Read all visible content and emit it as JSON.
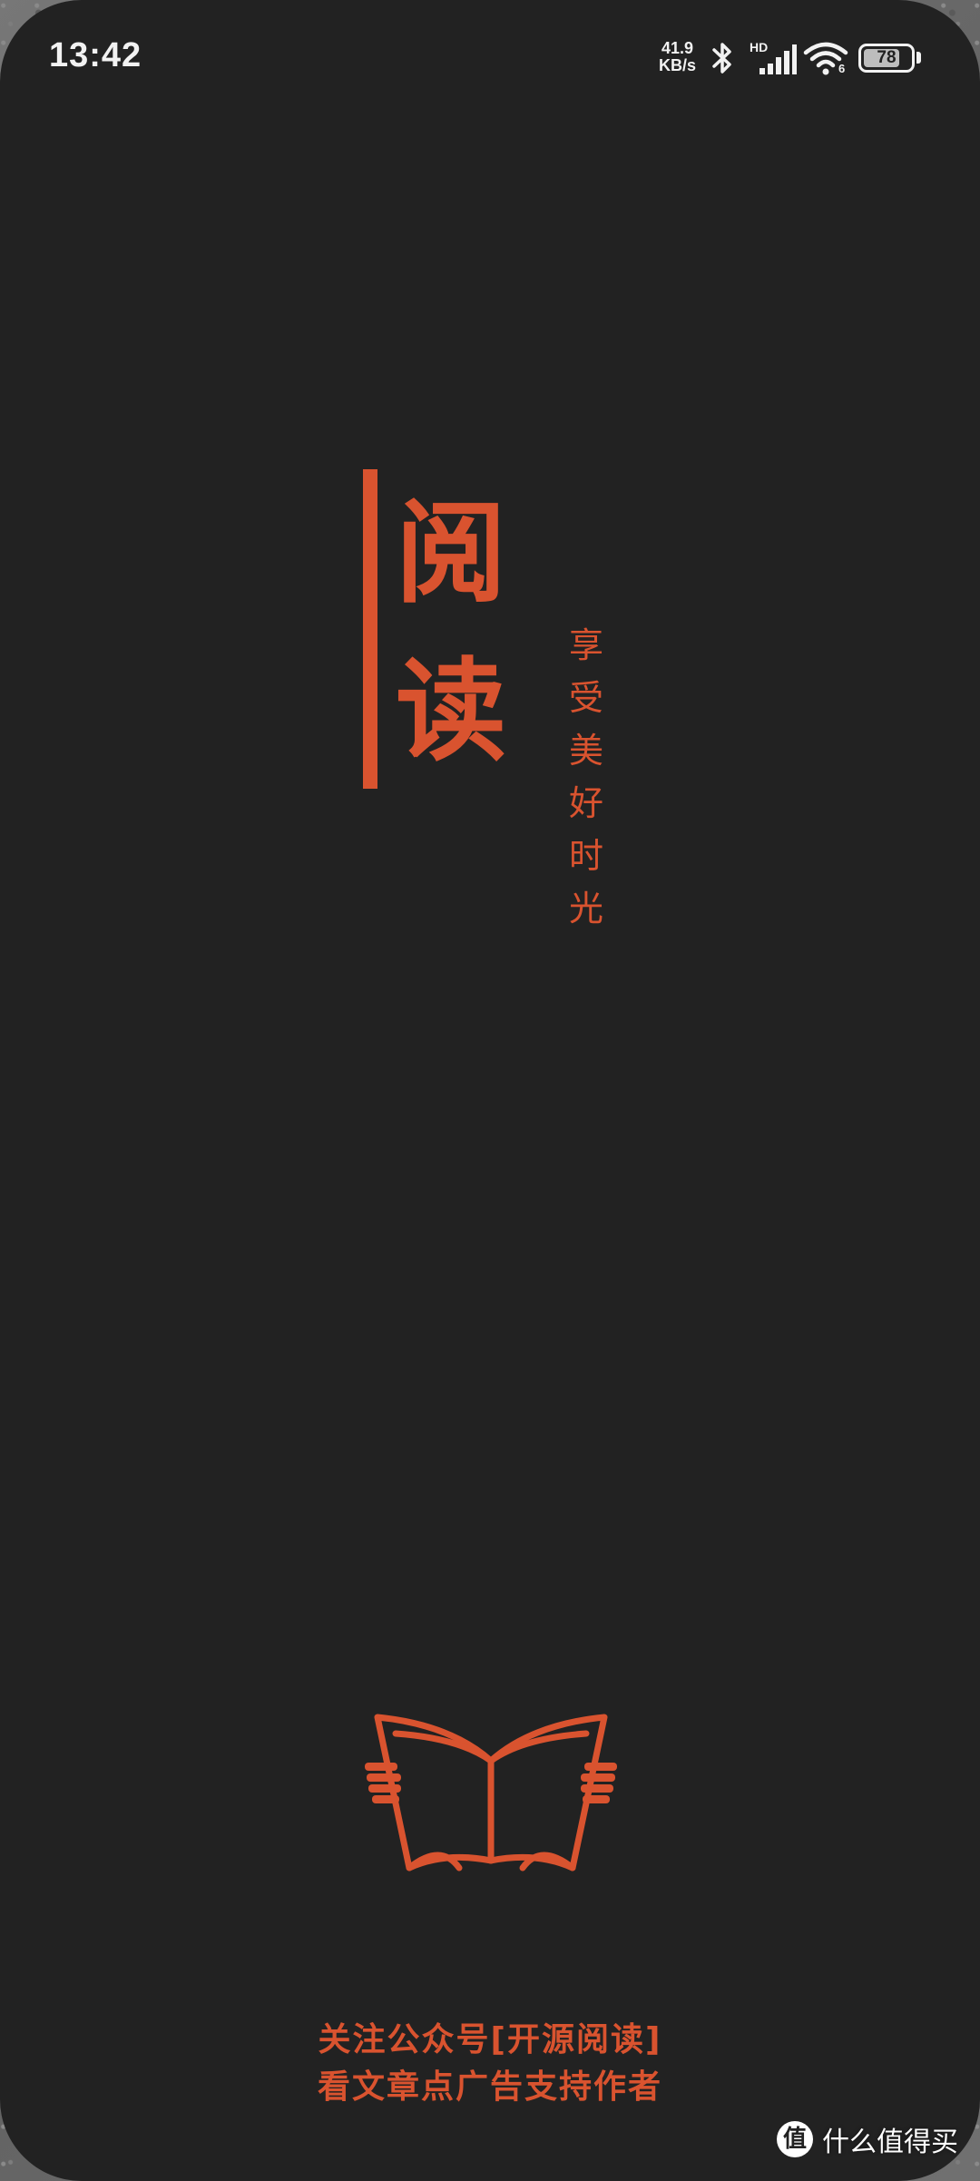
{
  "status_bar": {
    "time": "13:42",
    "net_speed_value": "41.9",
    "net_speed_unit": "KB/s",
    "hd_label": "HD",
    "wifi_sub": "6",
    "battery_percent": "78",
    "battery_level": 0.78
  },
  "splash": {
    "title_chars": [
      "阅",
      "读"
    ],
    "slogan_chars": [
      "享",
      "受",
      "美",
      "好",
      "时",
      "光"
    ],
    "accent_color": "#d9532f",
    "background_color": "#222222"
  },
  "footer": {
    "line1": "关注公众号[开源阅读]",
    "line2": "看文章点广告支持作者"
  },
  "watermark": {
    "logo_char": "值",
    "text": "什么值得买"
  },
  "icons": [
    "bluetooth-icon",
    "cellular-signal-icon",
    "wifi-icon",
    "battery-icon",
    "book-logo-icon"
  ]
}
